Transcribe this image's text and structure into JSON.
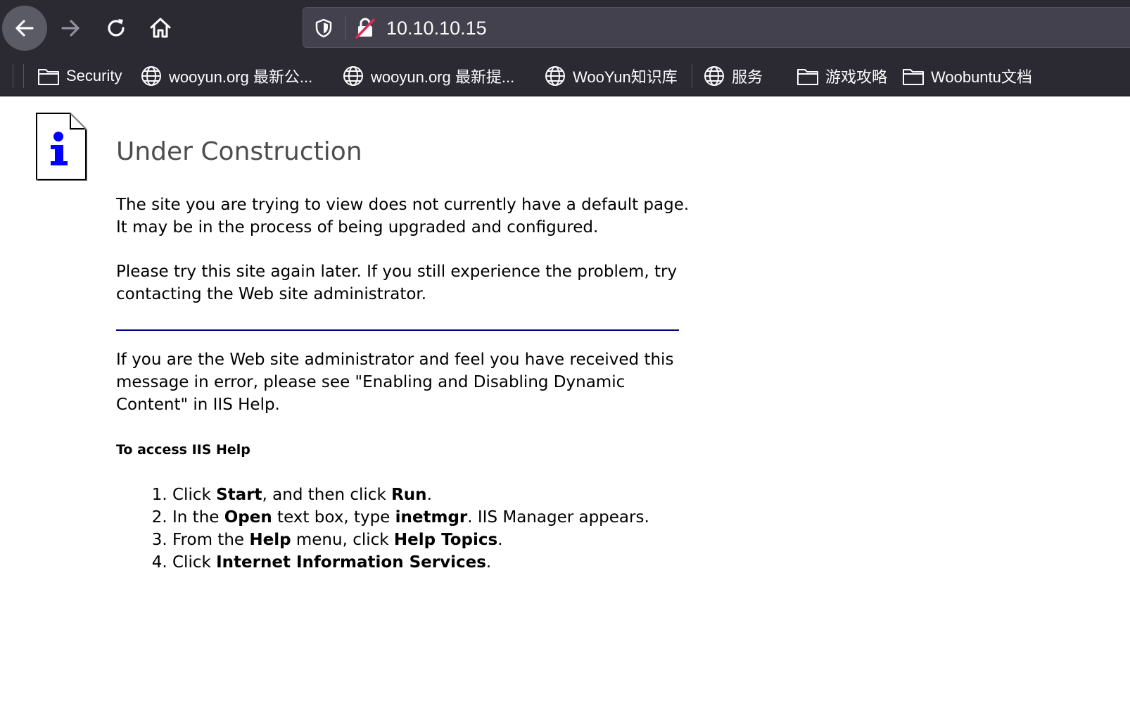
{
  "browser": {
    "url": "10.10.10.15",
    "bookmarks": [
      {
        "label": "Security",
        "icon": "folder-icon"
      },
      {
        "label": "wooyun.org 最新公...",
        "icon": "globe-icon"
      },
      {
        "label": "wooyun.org 最新提...",
        "icon": "globe-icon"
      },
      {
        "label": "WooYun知识库",
        "icon": "globe-icon"
      },
      {
        "label": "服务",
        "icon": "globe-icon"
      },
      {
        "label": "游戏攻略",
        "icon": "folder-icon"
      },
      {
        "label": "Woobuntu文档",
        "icon": "folder-icon"
      }
    ]
  },
  "page": {
    "title": "Under Construction",
    "para1": "The site you are trying to view does not currently have a default page. It may be in the process of being upgraded and configured.",
    "para2": "Please try this site again later. If you still experience the problem, try contacting the Web site administrator.",
    "para3": "If you are the Web site administrator and feel you have received this message in error, please see \"Enabling and Disabling Dynamic Content\" in IIS Help.",
    "help_heading": "To access IIS Help",
    "steps": [
      {
        "t1": "Click ",
        "b1": "Start",
        "t2": ", and then click ",
        "b2": "Run",
        "t3": "."
      },
      {
        "t1": "In the ",
        "b1": "Open",
        "t2": " text box, type ",
        "b2": "inetmgr",
        "t3": ". IIS Manager appears."
      },
      {
        "t1": "From the ",
        "b1": "Help",
        "t2": " menu, click ",
        "b2": "Help Topics",
        "t3": "."
      },
      {
        "t1": "Click ",
        "b1": "Internet Information Services",
        "t2": ".",
        "b2": "",
        "t3": ""
      }
    ]
  },
  "colors": {
    "toolbar_bg": "#2b2a33",
    "urlbar_bg": "#42414d",
    "rule": "#000080",
    "title": "#4d4d4d"
  }
}
